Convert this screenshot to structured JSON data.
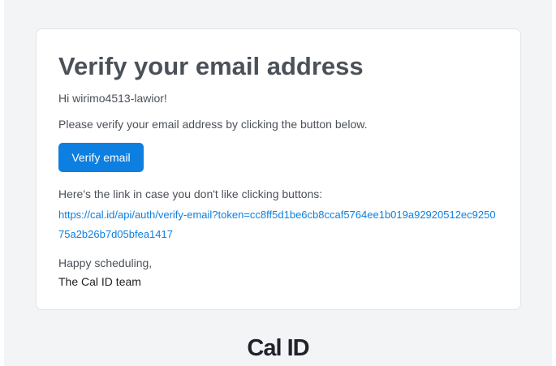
{
  "email": {
    "heading": "Verify your email address",
    "greeting": "Hi wirimo4513-lawior!",
    "instruction": "Please verify your email address by clicking the button below.",
    "button_label": "Verify email",
    "link_intro": "Here's the link in case you don't like clicking buttons:",
    "verify_link_text": "https://cal.id/api/auth/verify-email?token=cc8ff5d1be6cb8ccaf5764ee1b019a92920512ec925075a2b26b7d05bfea1417",
    "signoff": "Happy scheduling,",
    "team": "The Cal ID team"
  },
  "footer": {
    "logo_text": "Cal ID"
  },
  "colors": {
    "accent": "#0d7fe0",
    "background": "#f3f4f6",
    "text": "#4b5158"
  }
}
